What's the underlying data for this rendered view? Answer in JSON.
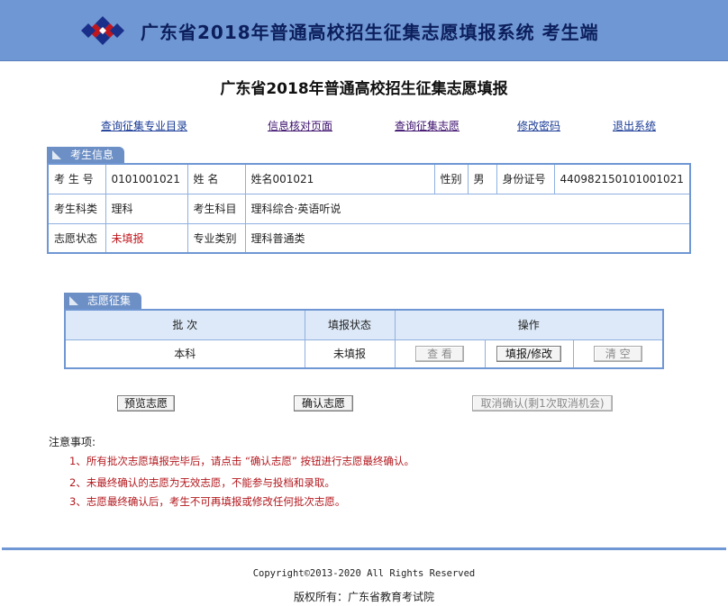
{
  "header": {
    "title": "广东省2018年普通高校招生征集志愿填报系统  考生端"
  },
  "page": {
    "title": "广东省2018年普通高校招生征集志愿填报"
  },
  "nav": {
    "items": [
      "查询征集专业目录",
      "信息核对页面",
      "查询征集志愿",
      "修改密码",
      "退出系统"
    ]
  },
  "student_info": {
    "section_label": "考生信息",
    "exam_no_label": "考 生 号",
    "exam_no": "0101001021",
    "name_label": "姓    名",
    "name": "姓名001021",
    "gender_label": "性别",
    "gender": "男",
    "id_label": "身份证号",
    "id_no": "440982150101001021",
    "category_label": "考生科类",
    "category": "理科",
    "subjects_label": "考生科目",
    "subjects": "理科综合·英语听说",
    "status_label": "志愿状态",
    "status": "未填报",
    "major_type_label": "专业类别",
    "major_type": "理科普通类"
  },
  "volunteer": {
    "section_label": "志愿征集",
    "headers": {
      "batch": "批     次",
      "status": "填报状态",
      "ops": "操作"
    },
    "row": {
      "batch": "本科",
      "status": "未填报",
      "view_label": "查  看",
      "edit_label": "填报/修改",
      "clear_label": "清  空"
    }
  },
  "actions": {
    "preview_label": "预览志愿",
    "confirm_label": "确认志愿",
    "cancel_label": "取消确认(剩1次取消机会)"
  },
  "notes": {
    "title": "注意事项:",
    "items": [
      "1、所有批次志愿填报完毕后，请点击 “确认志愿” 按钮进行志愿最终确认。",
      "2、未最终确认的志愿为无效志愿，不能参与投档和录取。",
      "3、志愿最终确认后，考生不可再填报或修改任何批次志愿。"
    ]
  },
  "footer": {
    "copyright": "Copyright©2013-2020  All Rights Reserved",
    "owner": "版权所有：广东省教育考试院"
  },
  "colors": {
    "header_bg": "#6f97d3",
    "table_border": "#6f97d3",
    "status_red": "#c0161d",
    "link_blue": "#1a3b96"
  }
}
